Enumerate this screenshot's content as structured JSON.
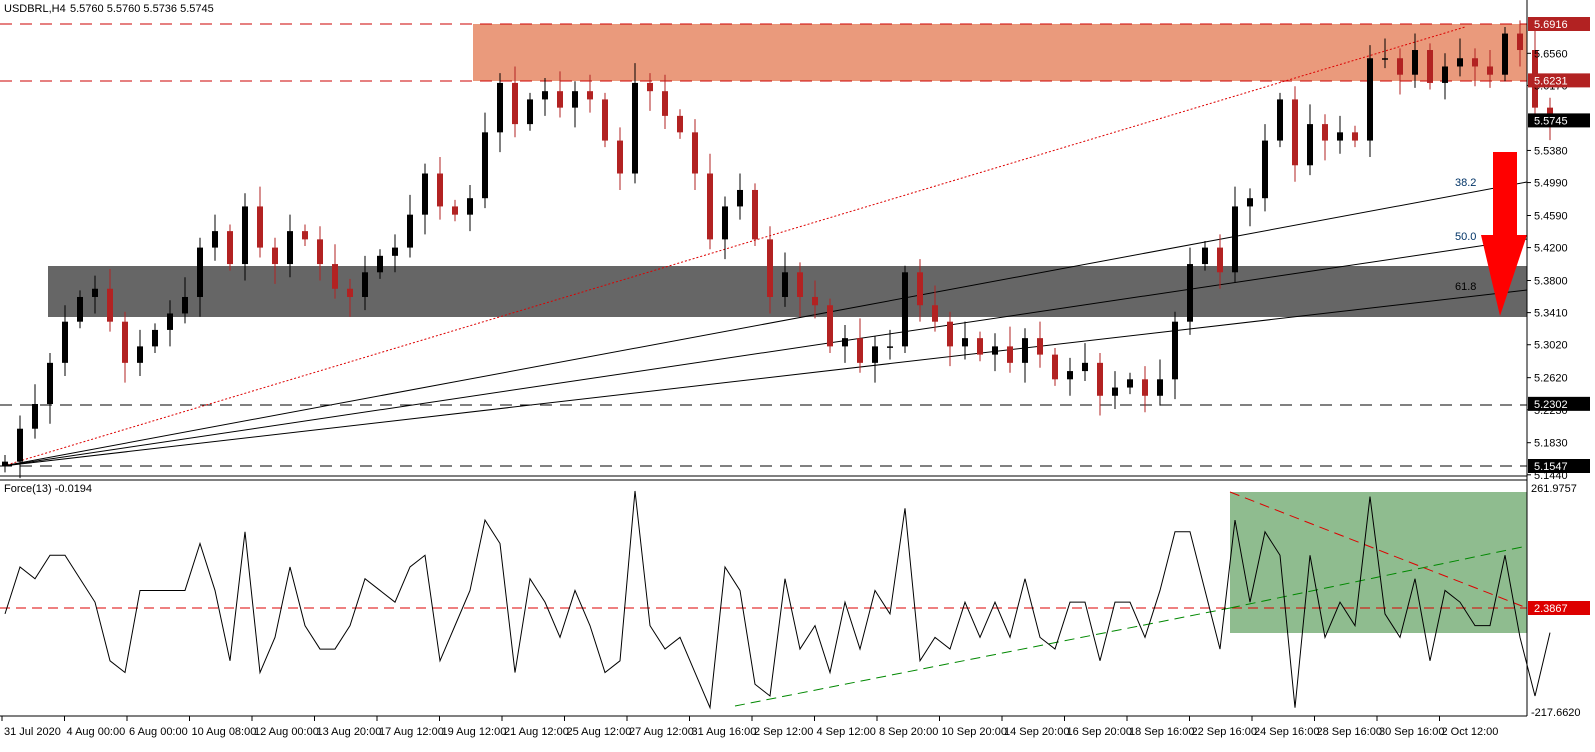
{
  "header": {
    "symbol": "USDBRL,H4",
    "ohlc": "5.5760 5.5760 5.5736 5.5745"
  },
  "indicator": {
    "label": "Force(13) -0.0194",
    "max_label": "261.9757",
    "min_label": "-217.6620",
    "level_label": "2.3867"
  },
  "colors": {
    "bull": "#000000",
    "bear": "#b22222",
    "resistance_zone": "#ea9a7c",
    "support_zone": "#666666",
    "force_zone": "#8fbc8f",
    "arrow": "#ff0000"
  },
  "chart_data": {
    "type": "candlestick",
    "title": "USDBRL,H4",
    "ylim": [
      5.144,
      5.6916
    ],
    "price_ticks": [
      "5.6560",
      "5.6170",
      "5.5380",
      "5.4990",
      "5.4590",
      "5.4200",
      "5.3800",
      "5.3410",
      "5.3020",
      "5.2620",
      "5.2230",
      "5.1830",
      "5.1440"
    ],
    "level_labels": [
      {
        "value": 5.6916,
        "text": "5.6916",
        "style": "red"
      },
      {
        "value": 5.6231,
        "text": "5.6231",
        "style": "red"
      },
      {
        "value": 5.5745,
        "text": "5.5745",
        "style": "black"
      },
      {
        "value": 5.2302,
        "text": "5.2302",
        "style": "black"
      },
      {
        "value": 5.1547,
        "text": "5.1547",
        "style": "black"
      }
    ],
    "fib_labels": [
      "38.2",
      "50.0",
      "61.8"
    ],
    "time_labels": [
      "31 Jul 2020",
      "4 Aug 00:00",
      "6 Aug 00:00",
      "10 Aug 08:00",
      "12 Aug 00:00",
      "13 Aug 20:00",
      "17 Aug 12:00",
      "19 Aug 12:00",
      "21 Aug 12:00",
      "25 Aug 12:00",
      "27 Aug 12:00",
      "31 Aug 16:00",
      "2 Sep 12:00",
      "4 Sep 12:00",
      "8 Sep 20:00",
      "10 Sep 20:00",
      "14 Sep 20:00",
      "16 Sep 20:00",
      "18 Sep 16:00",
      "22 Sep 16:00",
      "24 Sep 16:00",
      "28 Sep 16:00",
      "30 Sep 16:00",
      "2 Oct 12:00"
    ],
    "closes": [
      5.16,
      5.2,
      5.23,
      5.28,
      5.33,
      5.36,
      5.37,
      5.33,
      5.28,
      5.3,
      5.32,
      5.34,
      5.36,
      5.42,
      5.44,
      5.4,
      5.47,
      5.42,
      5.4,
      5.44,
      5.43,
      5.4,
      5.37,
      5.36,
      5.39,
      5.41,
      5.42,
      5.46,
      5.51,
      5.47,
      5.46,
      5.48,
      5.56,
      5.62,
      5.57,
      5.6,
      5.61,
      5.59,
      5.61,
      5.6,
      5.55,
      5.51,
      5.62,
      5.61,
      5.58,
      5.56,
      5.51,
      5.43,
      5.47,
      5.49,
      5.43,
      5.36,
      5.39,
      5.36,
      5.35,
      5.3,
      5.31,
      5.28,
      5.3,
      5.3,
      5.39,
      5.35,
      5.33,
      5.3,
      5.31,
      5.29,
      5.3,
      5.28,
      5.31,
      5.29,
      5.26,
      5.27,
      5.28,
      5.24,
      5.25,
      5.26,
      5.24,
      5.26,
      5.33,
      5.4,
      5.42,
      5.39,
      5.47,
      5.48,
      5.55,
      5.6,
      5.52,
      5.57,
      5.55,
      5.56,
      5.55,
      5.65,
      5.65,
      5.63,
      5.66,
      5.62,
      5.64,
      5.65,
      5.64,
      5.63,
      5.68,
      5.66,
      5.59,
      5.5745
    ],
    "force": [
      0,
      100,
      75,
      125,
      125,
      75,
      25,
      -100,
      -125,
      50,
      50,
      50,
      50,
      150,
      50,
      -100,
      175,
      -125,
      -50,
      100,
      -25,
      -75,
      -75,
      -25,
      75,
      50,
      25,
      100,
      125,
      -100,
      -25,
      50,
      200,
      150,
      -125,
      75,
      25,
      -50,
      50,
      -25,
      -125,
      -100,
      262,
      -25,
      -75,
      -50,
      -125,
      -200,
      100,
      50,
      -150,
      -175,
      75,
      -75,
      -25,
      -125,
      25,
      -75,
      50,
      0,
      225,
      -100,
      -50,
      -75,
      25,
      -50,
      25,
      -50,
      75,
      -50,
      -75,
      25,
      25,
      -100,
      25,
      25,
      -50,
      50,
      175,
      175,
      50,
      -75,
      200,
      25,
      175,
      125,
      -200,
      125,
      -50,
      25,
      -25,
      250,
      0,
      -50,
      75,
      -100,
      50,
      25,
      -25,
      -25,
      125,
      -50,
      -175,
      -40
    ],
    "force_ylim": [
      -217.662,
      261.9757
    ]
  }
}
